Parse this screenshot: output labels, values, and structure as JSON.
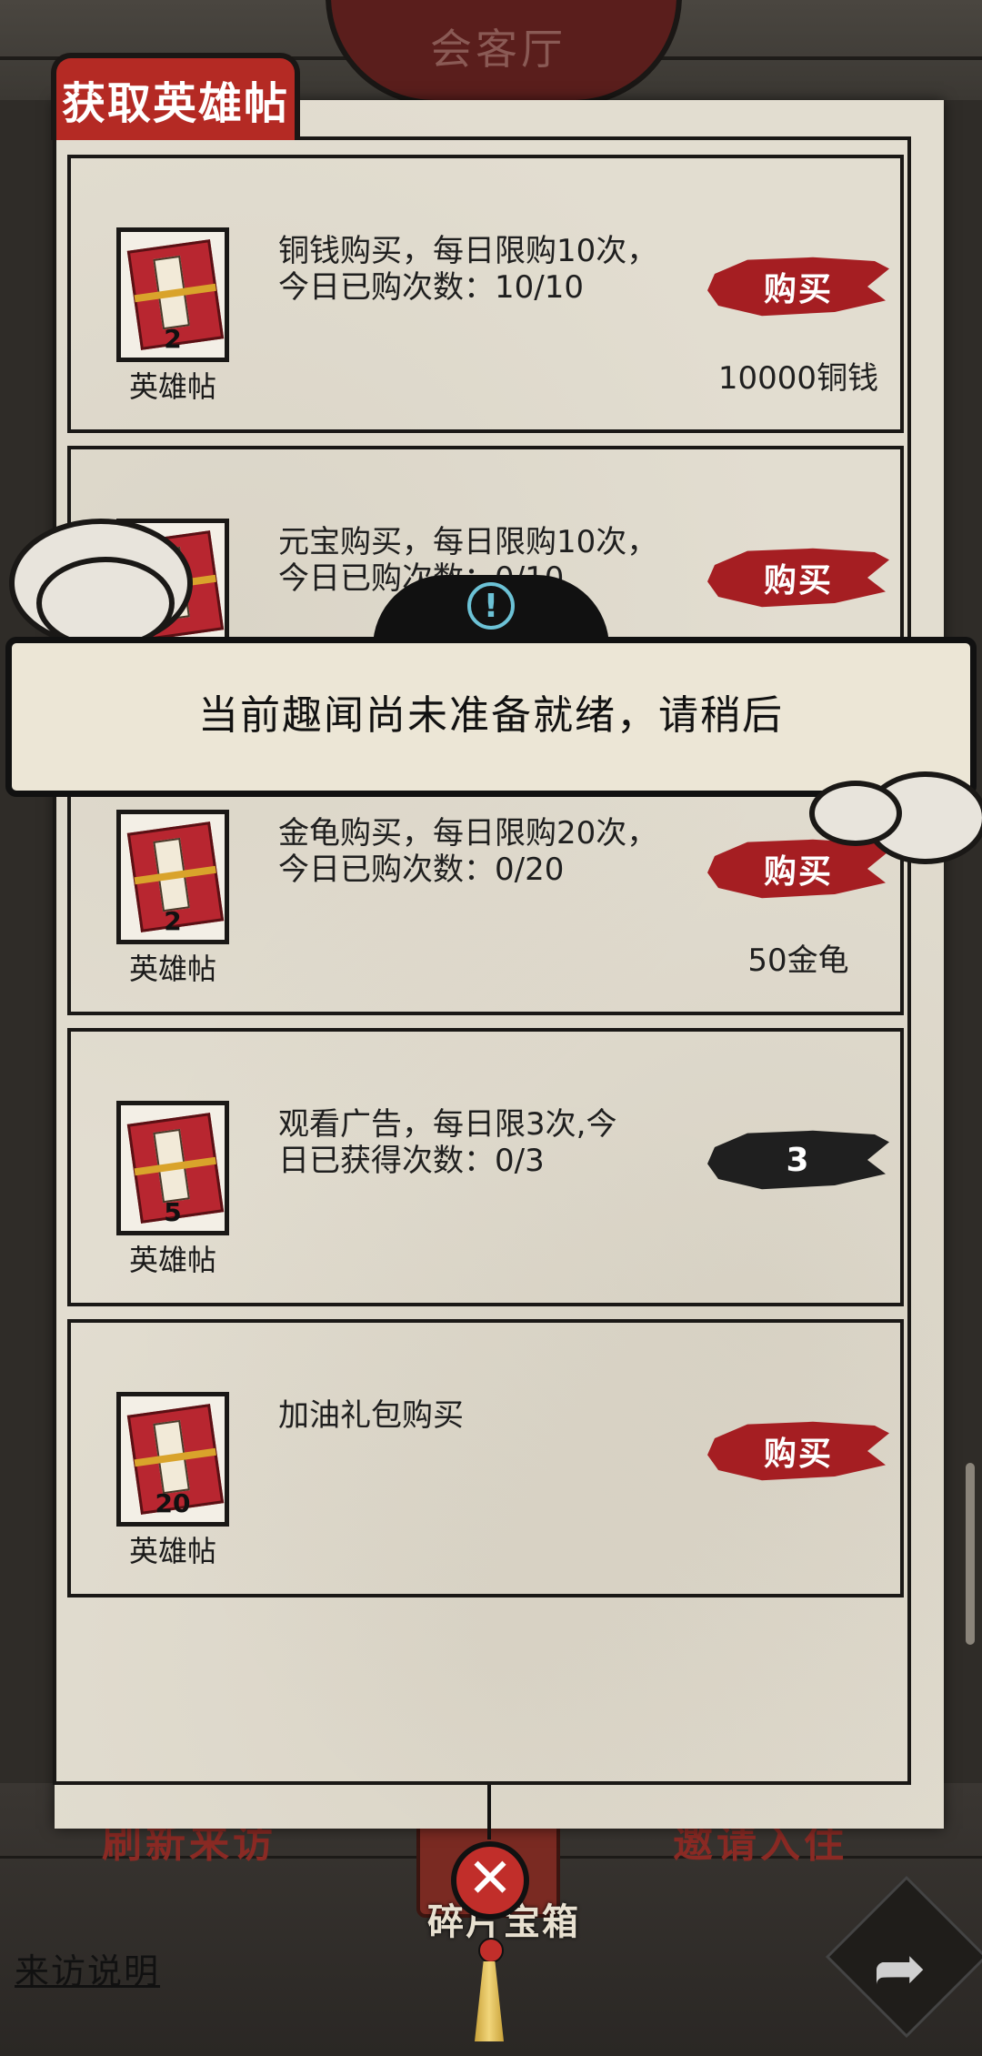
{
  "header": {
    "hall_title": "会客厅"
  },
  "panel": {
    "title": "获取英雄帖"
  },
  "rows": [
    {
      "icon_name": "英雄帖",
      "count": "2",
      "desc_line1": "铜钱购买，每日限购10次，",
      "desc_line2": "今日已购次数：10/10",
      "button": "购买",
      "price": "10000铜钱"
    },
    {
      "icon_name": "英雄帖",
      "count": "",
      "desc_line1": "元宝购买，每日限购10次，",
      "desc_line2": "今日已购次数：0/10",
      "button": "购买",
      "price": ""
    },
    {
      "icon_name": "英雄帖",
      "count": "2",
      "desc_line1": "金龟购买，每日限购20次，",
      "desc_line2": "今日已购次数：0/20",
      "button": "购买",
      "price": "50金龟"
    },
    {
      "icon_name": "英雄帖",
      "count": "5",
      "desc_line1": "观看广告，每日限3次,今",
      "desc_line2": "日已获得次数：0/3",
      "button": "3",
      "price": ""
    },
    {
      "icon_name": "英雄帖",
      "count": "20",
      "desc_line1": "加油礼包购买",
      "desc_line2": "",
      "button": "购买",
      "price": ""
    }
  ],
  "toast": {
    "message": "当前趣闻尚未准备就绪，请稍后",
    "icon": "info-icon"
  },
  "background": {
    "refresh_visit": "刷新来访",
    "invite_stay": "邀请入住",
    "chest_label": "碎片宝箱",
    "visit_info": "来访说明"
  },
  "colors": {
    "accent_red": "#b42a24",
    "paper": "#e2ddd0",
    "ink": "#1a1816",
    "info_cyan": "#6cc2d6"
  }
}
